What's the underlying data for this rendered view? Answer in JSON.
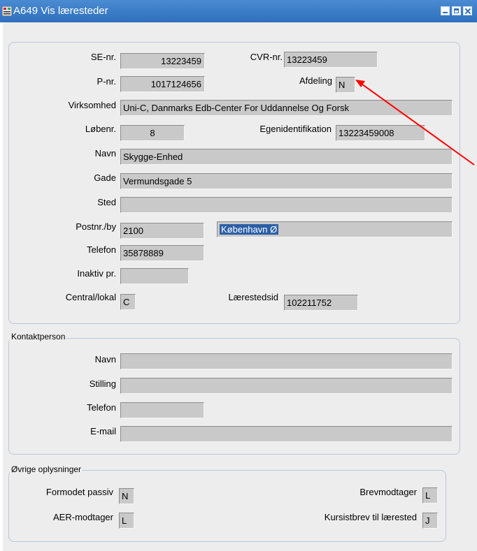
{
  "window": {
    "title": "A649 Vis læresteder"
  },
  "main": {
    "se_nr": {
      "label": "SE-nr.",
      "value": "13223459"
    },
    "cvr_nr": {
      "label": "CVR-nr.",
      "value": "13223459"
    },
    "p_nr": {
      "label": "P-nr.",
      "value": "1017124656"
    },
    "afdeling": {
      "label": "Afdeling",
      "value": "N"
    },
    "virksomhed": {
      "label": "Virksomhed",
      "value": "Uni-C, Danmarks Edb-Center For Uddannelse Og Forsk"
    },
    "lobenr": {
      "label": "Løbenr.",
      "value": "8"
    },
    "egenidentifikation": {
      "label": "Egenidentifikation",
      "value": "13223459008"
    },
    "navn": {
      "label": "Navn",
      "value": "Skygge-Enhed"
    },
    "gade": {
      "label": "Gade",
      "value": "Vermundsgade 5"
    },
    "sted": {
      "label": "Sted",
      "value": ""
    },
    "postnr_by": {
      "label": "Postnr./by",
      "postnr": "2100",
      "by": "København Ø"
    },
    "telefon": {
      "label": "Telefon",
      "value": "35878889"
    },
    "inaktiv": {
      "label": "Inaktiv pr.",
      "value": ""
    },
    "central_lokal": {
      "label": "Central/lokal",
      "value": "C"
    },
    "laerestedsid": {
      "label": "Lærestedsid",
      "value": "102211752"
    }
  },
  "kontakt": {
    "title": "Kontaktperson",
    "navn": {
      "label": "Navn",
      "value": ""
    },
    "stilling": {
      "label": "Stilling",
      "value": ""
    },
    "telefon": {
      "label": "Telefon",
      "value": ""
    },
    "email": {
      "label": "E-mail",
      "value": ""
    }
  },
  "ovrige": {
    "title": "Øvrige oplysninger",
    "formodet_passiv": {
      "label": "Formodet passiv",
      "value": "N"
    },
    "brevmodtager": {
      "label": "Brevmodtager",
      "value": "L"
    },
    "aer_modtager": {
      "label": "AER-modtager",
      "value": "L"
    },
    "kursistbrev": {
      "label": "Kursistbrev til lærested",
      "value": "J"
    }
  },
  "colors": {
    "titlebar": "#2f6fbd",
    "field": "#c9c9c9",
    "background": "#ededed",
    "annotation_arrow": "#ff0000"
  },
  "icons": {
    "app": "form-app-icon",
    "annotation": "red-arrow-annotation"
  }
}
